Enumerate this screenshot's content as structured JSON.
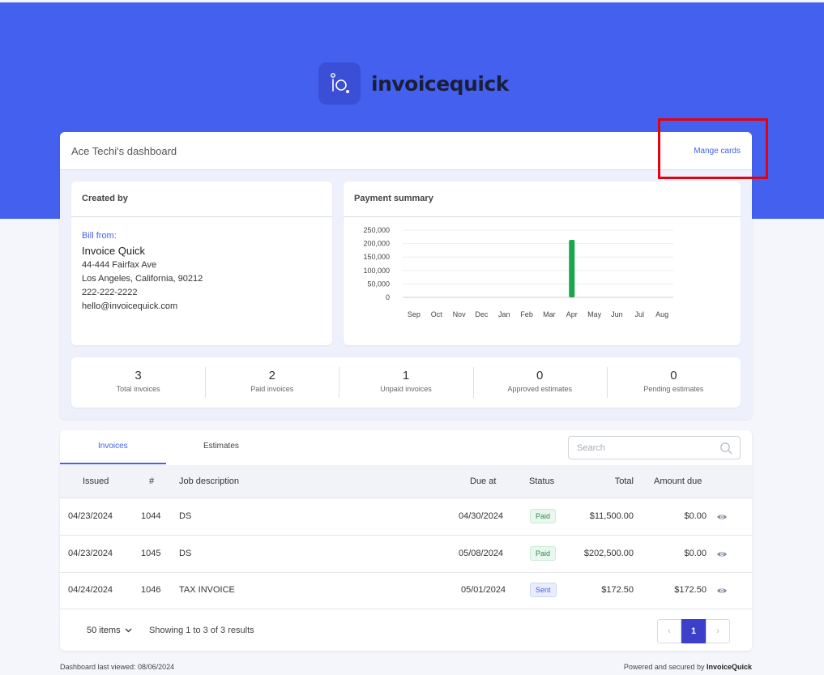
{
  "brand": {
    "name": "invoicequick",
    "logo_icon": "iq-logo-icon",
    "primary_color": "#4361ee"
  },
  "dashboard": {
    "title": "Ace Techi's dashboard",
    "manage_cards_label": "Mange cards"
  },
  "created_by": {
    "heading": "Created by",
    "bill_from_label": "Bill from:",
    "company": "Invoice Quick",
    "address_line1": "44-444 Fairfax Ave",
    "address_line2": "Los Angeles, California, 90212",
    "phone": "222-222-2222",
    "email": "hello@invoicequick.com"
  },
  "payment_summary": {
    "heading": "Payment summary"
  },
  "chart_data": {
    "type": "bar",
    "categories": [
      "Sep",
      "Oct",
      "Nov",
      "Dec",
      "Jan",
      "Feb",
      "Mar",
      "Apr",
      "May",
      "Jun",
      "Jul",
      "Aug"
    ],
    "values": [
      0,
      0,
      0,
      0,
      0,
      0,
      0,
      214000,
      0,
      0,
      0,
      0
    ],
    "ylim": [
      0,
      250000
    ],
    "yticks": [
      0,
      50000,
      100000,
      150000,
      200000,
      250000
    ],
    "ytick_labels": [
      "0",
      "50,000",
      "100,000",
      "150,000",
      "200,000",
      "250,000"
    ],
    "grid": true,
    "bar_color": "#1aa64f"
  },
  "stats": [
    {
      "value": "3",
      "label": "Total invoices"
    },
    {
      "value": "2",
      "label": "Paid invoices"
    },
    {
      "value": "1",
      "label": "Unpaid invoices"
    },
    {
      "value": "0",
      "label": "Approved estimates"
    },
    {
      "value": "0",
      "label": "Pending estimates"
    }
  ],
  "tabs": {
    "invoices": "Invoices",
    "estimates": "Estimates"
  },
  "search": {
    "placeholder": "Search",
    "icon": "search-icon"
  },
  "table": {
    "headers": {
      "issued": "Issued",
      "number": "#",
      "job": "Job description",
      "due": "Due at",
      "status": "Status",
      "total": "Total",
      "amount_due": "Amount due"
    },
    "rows": [
      {
        "issued": "04/23/2024",
        "number": "1044",
        "job": "DS",
        "due": "04/30/2024",
        "status": "Paid",
        "total": "$11,500.00",
        "amount_due": "$0.00"
      },
      {
        "issued": "04/23/2024",
        "number": "1045",
        "job": "DS",
        "due": "05/08/2024",
        "status": "Paid",
        "total": "$202,500.00",
        "amount_due": "$0.00"
      },
      {
        "issued": "04/24/2024",
        "number": "1046",
        "job": "TAX INVOICE",
        "due": "05/01/2024",
        "status": "Sent",
        "total": "$172.50",
        "amount_due": "$172.50"
      }
    ]
  },
  "pagination": {
    "per_page": "50 items",
    "showing": "Showing 1 to 3 of 3 results",
    "current_page": "1",
    "prev": "‹",
    "next": "›"
  },
  "footer": {
    "last_viewed": "Dashboard last viewed: 08/06/2024",
    "powered_prefix": "Powered and secured by",
    "powered_brand": "InvoiceQuick"
  }
}
